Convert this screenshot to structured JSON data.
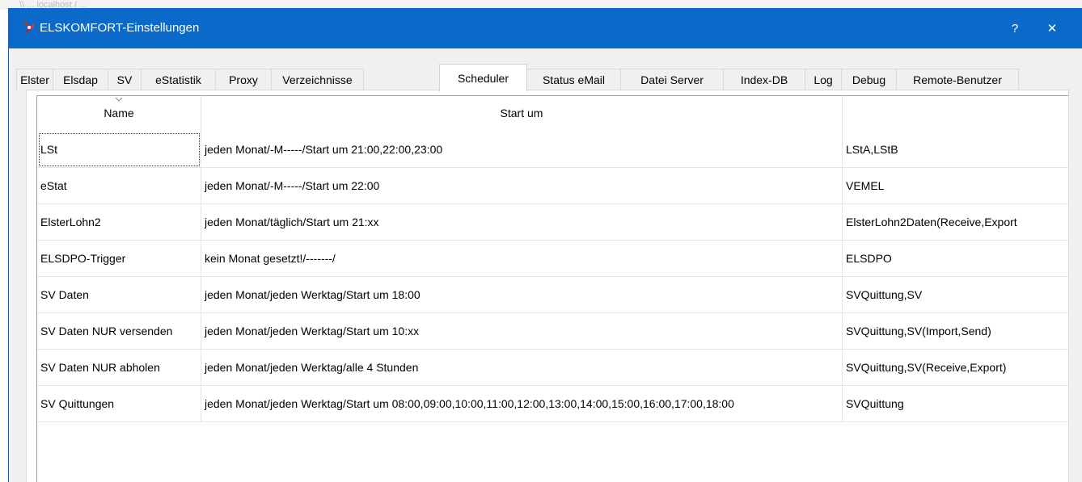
{
  "background_hint": "\\\\ ... localhost / ...",
  "window": {
    "title": "ELSKOMFORT-Einstellungen",
    "help_label": "?",
    "close_label": "✕",
    "titlebar_color": "#0b6ac9"
  },
  "tabs": [
    {
      "label": "Elster",
      "active": false
    },
    {
      "label": "Elsdap",
      "active": false
    },
    {
      "label": "SV",
      "active": false
    },
    {
      "label": "eStatistik",
      "active": false
    },
    {
      "label": "Proxy",
      "active": false
    },
    {
      "label": "Verzeichnisse",
      "active": false
    },
    {
      "label": "Scheduler",
      "active": true
    },
    {
      "label": "Status eMail",
      "active": false
    },
    {
      "label": "Datei Server",
      "active": false
    },
    {
      "label": "Index-DB",
      "active": false
    },
    {
      "label": "Log",
      "active": false
    },
    {
      "label": "Debug",
      "active": false
    },
    {
      "label": "Remote-Benutzer",
      "active": false
    }
  ],
  "table": {
    "columns": [
      "Name",
      "Start um",
      ""
    ],
    "rows": [
      {
        "name": "LSt",
        "start": "jeden Monat/-M-----/Start um 21:00,22:00,23:00",
        "target": "LStA,LStB"
      },
      {
        "name": "eStat",
        "start": "jeden Monat/-M-----/Start um 22:00",
        "target": "VEMEL"
      },
      {
        "name": "ElsterLohn2",
        "start": "jeden Monat/täglich/Start um 21:xx",
        "target": "ElsterLohn2Daten(Receive,Export"
      },
      {
        "name": "ELSDPO-Trigger",
        "start": "kein Monat gesetzt!/-------/",
        "target": "ELSDPO"
      },
      {
        "name": "SV Daten",
        "start": "jeden Monat/jeden Werktag/Start um 18:00",
        "target": "SVQuittung,SV"
      },
      {
        "name": "SV Daten NUR versenden",
        "start": "jeden Monat/jeden Werktag/Start um 10:xx",
        "target": "SVQuittung,SV(Import,Send)"
      },
      {
        "name": "SV Daten NUR abholen",
        "start": "jeden Monat/jeden Werktag/alle 4 Stunden",
        "target": "SVQuittung,SV(Receive,Export)"
      },
      {
        "name": "SV Quittungen",
        "start": "jeden Monat/jeden Werktag/Start um 08:00,09:00,10:00,11:00,12:00,13:00,14:00,15:00,16:00,17:00,18:00",
        "target": "SVQuittung"
      }
    ]
  }
}
